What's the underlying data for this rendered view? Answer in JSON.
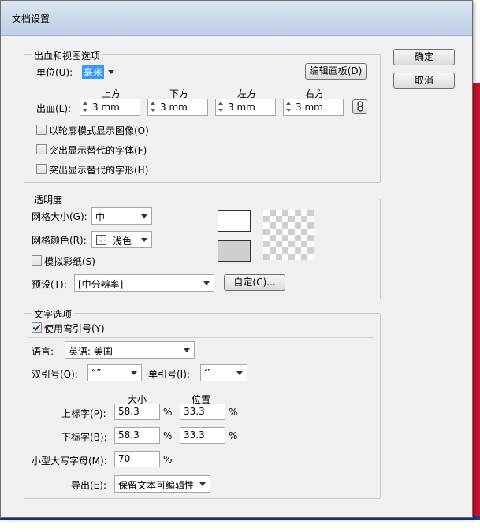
{
  "window": {
    "title": "文档设置"
  },
  "buttons": {
    "ok": "确定",
    "cancel": "取消"
  },
  "bleed_view": {
    "legend": "出血和视图选项",
    "unit_label": "单位(U):",
    "unit_value": "毫米",
    "edit_artboard": "编辑画板(D)",
    "bleed_label": "出血(L):",
    "sides": [
      {
        "header": "上方",
        "value": "3 mm"
      },
      {
        "header": "下方",
        "value": "3 mm"
      },
      {
        "header": "左方",
        "value": "3 mm"
      },
      {
        "header": "右方",
        "value": "3 mm"
      }
    ],
    "link_icon": "chain-link-icon",
    "options": [
      {
        "label": "以轮廓模式显示图像(O)",
        "checked": false
      },
      {
        "label": "突出显示替代的字体(F)",
        "checked": false
      },
      {
        "label": "突出显示替代的字形(H)",
        "checked": false
      }
    ]
  },
  "transparency": {
    "legend": "透明度",
    "grid_size_label": "网格大小(G):",
    "grid_size_value": "中",
    "grid_color_label": "网格颜色(R):",
    "grid_color_value": "浅色",
    "simulate_paper_label": "模拟彩纸(S)",
    "simulate_paper_checked": false,
    "preset_label": "预设(T):",
    "preset_value": "[中分辨率]",
    "custom_button": "自定(C)..."
  },
  "type_options": {
    "legend": "文字选项",
    "smart_quotes_label": "使用弯引号(Y)",
    "smart_quotes_checked": true,
    "language_label": "语言:",
    "language_value": "英语: 美国",
    "double_quotes_label": "双引号(Q):",
    "double_quotes_value": "“”",
    "single_quotes_label": "单引号(I):",
    "single_quotes_value": "‘’",
    "size_header": "大小",
    "position_header": "位置",
    "superscript_label": "上标字(P):",
    "superscript_size": "58.3",
    "superscript_position": "33.3",
    "subscript_label": "下标字(B):",
    "subscript_size": "58.3",
    "subscript_position": "33.3",
    "small_caps_label": "小型大写字母(M):",
    "small_caps_value": "70",
    "percent": "%",
    "export_label": "导出(E):",
    "export_value": "保留文本可编辑性"
  },
  "colors": {
    "accent_selection": "#3399ff",
    "bg_red": "#c8102e",
    "bg_blue": "#1d3a8a"
  }
}
